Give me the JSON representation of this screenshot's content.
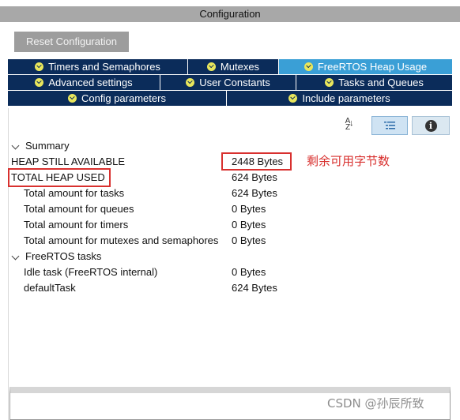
{
  "window": {
    "title": "Configuration"
  },
  "toolbar": {
    "reset_label": "Reset Configuration"
  },
  "tabs": {
    "row1": [
      {
        "label": "Timers and Semaphores",
        "active": false
      },
      {
        "label": "Mutexes",
        "active": false
      },
      {
        "label": "FreeRTOS Heap Usage",
        "active": true
      }
    ],
    "row2": [
      {
        "label": "Advanced settings",
        "active": false
      },
      {
        "label": "User Constants",
        "active": false
      },
      {
        "label": "Tasks and Queues",
        "active": false
      }
    ],
    "row3": [
      {
        "label": "Config parameters",
        "active": false
      },
      {
        "label": "Include parameters",
        "active": false
      }
    ]
  },
  "icons": {
    "sort": "sort-az-icon",
    "list": "list-view-icon",
    "info": "info-icon"
  },
  "tree": {
    "summary": {
      "label": "Summary",
      "heap_still_available": {
        "label": "HEAP STILL AVAILABLE",
        "value": "2448  Bytes"
      },
      "total_heap_used": {
        "label": "TOTAL HEAP USED",
        "value": "624  Bytes"
      },
      "tasks": {
        "label": "Total amount for tasks",
        "value": "624  Bytes"
      },
      "queues": {
        "label": "Total amount for queues",
        "value": "0  Bytes"
      },
      "timers": {
        "label": "Total amount for timers",
        "value": "0  Bytes"
      },
      "mutexes": {
        "label": "Total amount for mutexes and semaphores",
        "value": "0  Bytes"
      }
    },
    "freertos_tasks": {
      "label": "FreeRTOS tasks",
      "idle": {
        "label": "Idle task (FreeRTOS internal)",
        "value": "0  Bytes"
      },
      "default": {
        "label": "defaultTask",
        "value": "624  Bytes"
      }
    }
  },
  "annotation": "剩余可用字节数",
  "watermark": "CSDN @孙辰所致",
  "colors": {
    "tab_bg": "#0b2c5a",
    "tab_active": "#3a9fd6",
    "highlight_red": "#d8302e",
    "check_yellow": "#e8e65c"
  }
}
